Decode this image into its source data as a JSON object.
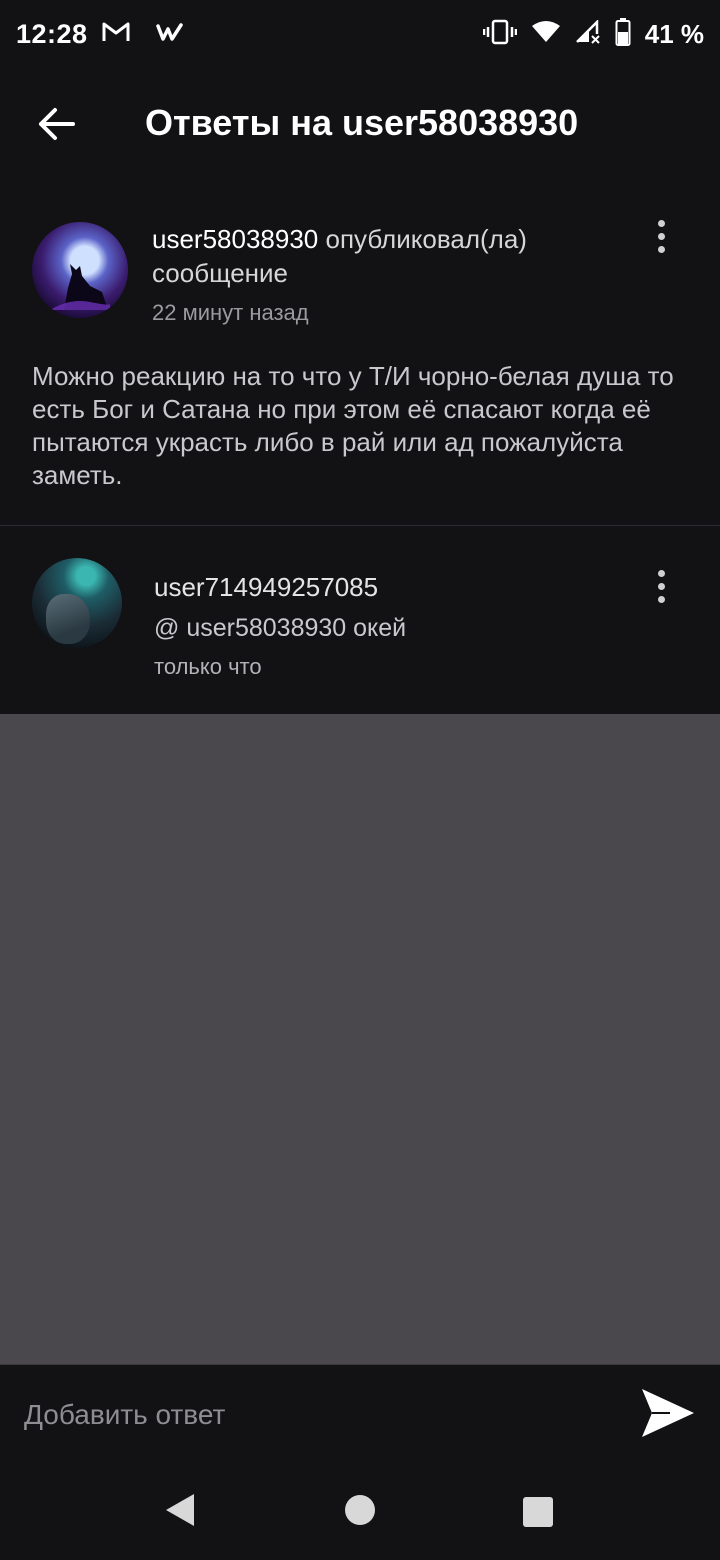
{
  "status_bar": {
    "time": "12:28",
    "battery": "41 %",
    "icons": [
      "gmail-icon",
      "wattpad-icon",
      "vibrate-icon",
      "wifi-icon",
      "signal-icon",
      "battery-icon"
    ]
  },
  "app_bar": {
    "title": "Ответы на user58038930",
    "back_icon": "arrow-left-icon"
  },
  "post": {
    "username": "user58038930",
    "action": " опубликовал(ла) сообщение",
    "time": "22 минут назад",
    "body": "Можно реакцию на то что у Т/И  чорно-белая душа то есть Бог и Сатана но при этом её спасают когда её пытаются украсть либо в рай или ад пожалуйста заметь."
  },
  "reply": {
    "username": "user714949257085",
    "mention": "@ user58038930",
    "text": " окей",
    "time": "только что"
  },
  "composer": {
    "placeholder": "Добавить ответ",
    "send_icon": "send-icon"
  },
  "nav_bar": {
    "icons": [
      "back-triangle-icon",
      "home-circle-icon",
      "recents-square-icon"
    ]
  },
  "colors": {
    "background": "#121114",
    "empty_area": "#4a484d",
    "text_primary": "#ffffff",
    "text_secondary": "#9b9a9e"
  }
}
